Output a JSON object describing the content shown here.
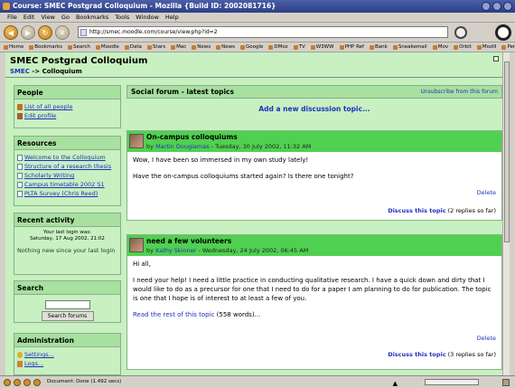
{
  "window": {
    "title": "Course: SMEC Postgrad Colloquium - Mozilla {Build ID: 2002081716}"
  },
  "menu": [
    "File",
    "Edit",
    "View",
    "Go",
    "Bookmarks",
    "Tools",
    "Window",
    "Help"
  ],
  "url": "http://smec.moodle.com/course/view.php?id=2",
  "bookmarks": [
    "Home",
    "Bookmarks",
    "Search",
    "Moodle",
    "Data",
    "Stars",
    "Mac",
    "News",
    "News",
    "Google",
    "DMoz",
    "TV",
    "W3WW",
    "PHP Ref",
    "Bank",
    "Sneakemail",
    "Mov",
    "Orbit",
    "Mozill",
    "PerthCams"
  ],
  "page": {
    "site_name": "SMEC Postgrad Colloquium",
    "breadcrumb_home": "SMEC",
    "breadcrumb_sep": "->",
    "breadcrumb_current": "Colloquium"
  },
  "people": {
    "title": "People",
    "items": [
      "List of all people",
      "Edit profile"
    ]
  },
  "resources": {
    "title": "Resources",
    "items": [
      "Welcome to the Colloquium",
      "Structure of a research thesis",
      "Scholarly Writing",
      "Campus timetable 2002 S1",
      "PLTA Survey (Chris Reed)"
    ]
  },
  "recent": {
    "title": "Recent activity",
    "last_login_label": "Your last login was:",
    "last_login_date": "Saturday, 17 Aug 2002, 21:02",
    "nothing_new": "Nothing new since your last login"
  },
  "search": {
    "title": "Search",
    "button": "Search forums"
  },
  "admin": {
    "title": "Administration",
    "items": [
      "Settings...",
      "Logs..."
    ]
  },
  "forum": {
    "title": "Social forum - latest topics",
    "unsubscribe": "Unsubscribe from this forum",
    "add_topic": "Add a new discussion topic..."
  },
  "posts": [
    {
      "subject": "On-campus colloquiums",
      "by": "by",
      "author": "Martin Dougiamas",
      "date": " - Tuesday, 30 July 2002, 11:32 AM",
      "para1": "Wow, I have been so immersed in my own study lately!",
      "para2": "Have the on-campus colloquiums started again? Is there one tonight?",
      "delete": "Delete",
      "discuss": "Discuss this topic",
      "replies": " (2 replies so far)"
    },
    {
      "subject": "need a few volunteers",
      "by": "by",
      "author": "Kathy Skinner",
      "date": " - Wednesday, 24 July 2002, 06:45 AM",
      "para1": "Hi all,",
      "para2": "I need your help! I need a little practice in conducting qualitative research. I have a quick down and dirty that I would like to do as a precursor for one that I need to do for a paper I am planning to do for publication. The topic is one that I hope is of interest to at least a few of you.",
      "read_more": "Read the rest of this topic",
      "words": " (558 words)...",
      "delete": "Delete",
      "discuss": "Discuss this topic",
      "replies": " (3 replies so far)"
    }
  ],
  "status": {
    "text": "Document: Done (1.492 secs)"
  }
}
